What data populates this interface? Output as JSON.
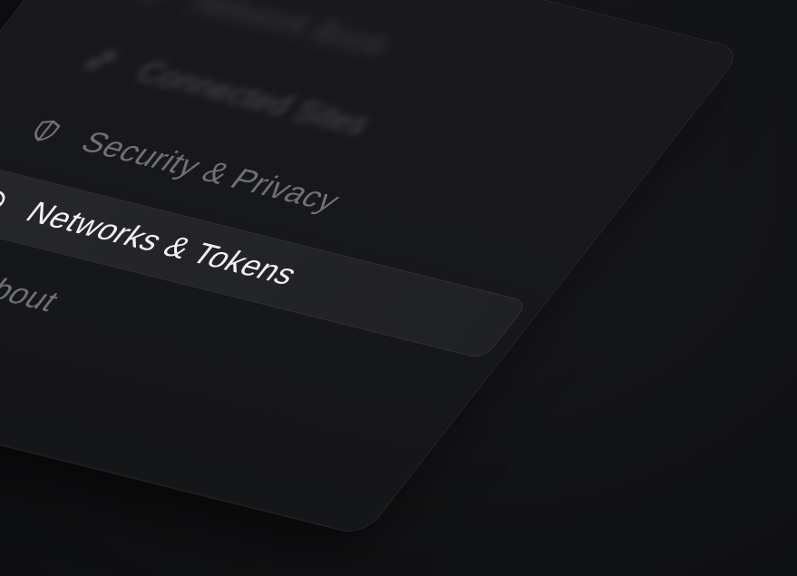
{
  "sidebar": {
    "items": [
      {
        "label": "Network Book",
        "icon": "wallet-icon",
        "state": "blurred"
      },
      {
        "label": "Connected Sites",
        "icon": "link-icon",
        "state": "blurred"
      },
      {
        "label": "Security & Privacy",
        "icon": "shield-icon",
        "state": "normal"
      },
      {
        "label": "Networks & Tokens",
        "icon": "globe-icon",
        "state": "active"
      },
      {
        "label": "About",
        "icon": "info-icon",
        "state": "normal"
      }
    ]
  },
  "colors": {
    "accent": "#22d3b4",
    "active_text": "#f2f2f4",
    "inactive_text": "#6f7075",
    "background": "#111214",
    "panel": "#17181b"
  }
}
